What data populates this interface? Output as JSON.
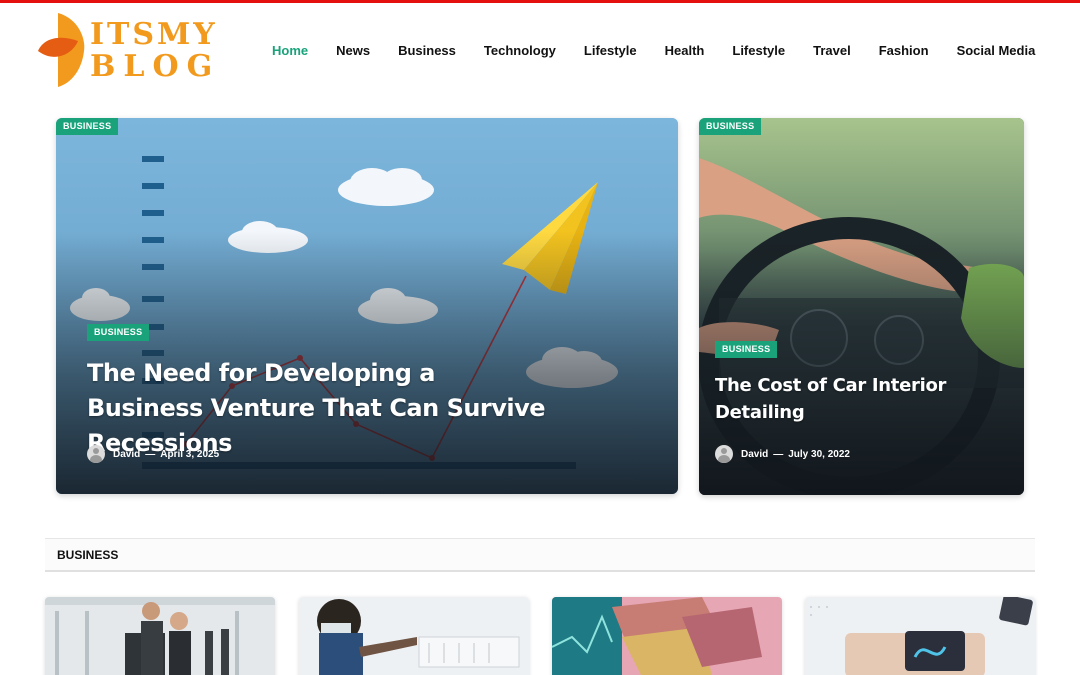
{
  "logo": {
    "line1": "ITSMY",
    "line2": "BLOG"
  },
  "nav": {
    "items": [
      {
        "label": "Home",
        "active": true
      },
      {
        "label": "News"
      },
      {
        "label": "Business"
      },
      {
        "label": "Technology"
      },
      {
        "label": "Lifestyle"
      },
      {
        "label": "Health"
      },
      {
        "label": "Lifestyle"
      },
      {
        "label": "Travel"
      },
      {
        "label": "Fashion"
      },
      {
        "label": "Social Media"
      }
    ]
  },
  "hero": {
    "main": {
      "corner_badge": "BUSINESS",
      "badge": "BUSINESS",
      "title": "The Need for Developing a Business Venture That Can Survive Recessions",
      "author": "David",
      "separator": "—",
      "date": "April 3, 2025"
    },
    "side": {
      "corner_badge": "BUSINESS",
      "badge": "BUSINESS",
      "title": "The Cost of Car Interior Detailing",
      "author": "David",
      "separator": "—",
      "date": "July 30, 2022"
    }
  },
  "section": {
    "title": "BUSINESS"
  },
  "colors": {
    "accent": "#1aa37a",
    "top_bar": "#e3100f",
    "logo": "#f29a1d"
  }
}
